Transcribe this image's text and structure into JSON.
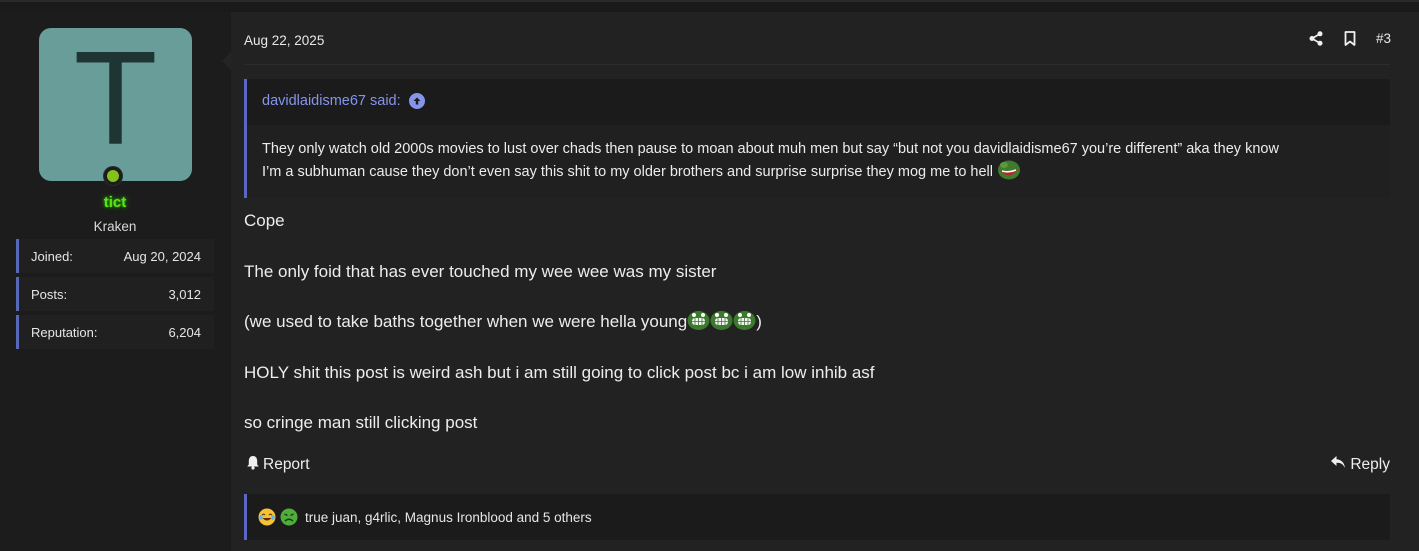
{
  "user": {
    "avatar_letter": "T",
    "username": "tict",
    "title": "Kraken",
    "stats": [
      {
        "label": "Joined:",
        "value": "Aug 20, 2024"
      },
      {
        "label": "Posts:",
        "value": "3,012"
      },
      {
        "label": "Reputation:",
        "value": "6,204"
      }
    ]
  },
  "post": {
    "date": "Aug 22, 2025",
    "number": "#3",
    "actions": {
      "share_icon": "share-icon",
      "bookmark_icon": "bookmark-icon"
    },
    "quote": {
      "author_said": "davidlaidisme67 said:",
      "line1": "They only watch old 2000s movies to lust over chads then pause to moan about muh men but say “but not you davidlaidisme67 you’re different” aka they know",
      "line2": "I’m a subhuman cause they don’t even say this shit to my older brothers and surprise surprise they mog me to hell"
    },
    "body": {
      "line1": "Cope",
      "line2": "The only foid that has ever touched my wee wee was my sister",
      "line3_text": "(we used to take baths together when we were hella young",
      "line3_close": ")",
      "line4": "HOLY shit this post is weird ash but i am still going to click post bc i am low inhib asf",
      "line5": "so cringe man still clicking post"
    },
    "report_label": "Report",
    "reply_label": "Reply",
    "reactions": {
      "names": "true juan, g4rlic, Magnus Ironblood and 5 others"
    }
  },
  "colors": {
    "accent": "#5a67c4",
    "link": "#8595ec",
    "username": "#5fe21a",
    "avatar_bg": "#689d99",
    "online": "#82c21b"
  }
}
